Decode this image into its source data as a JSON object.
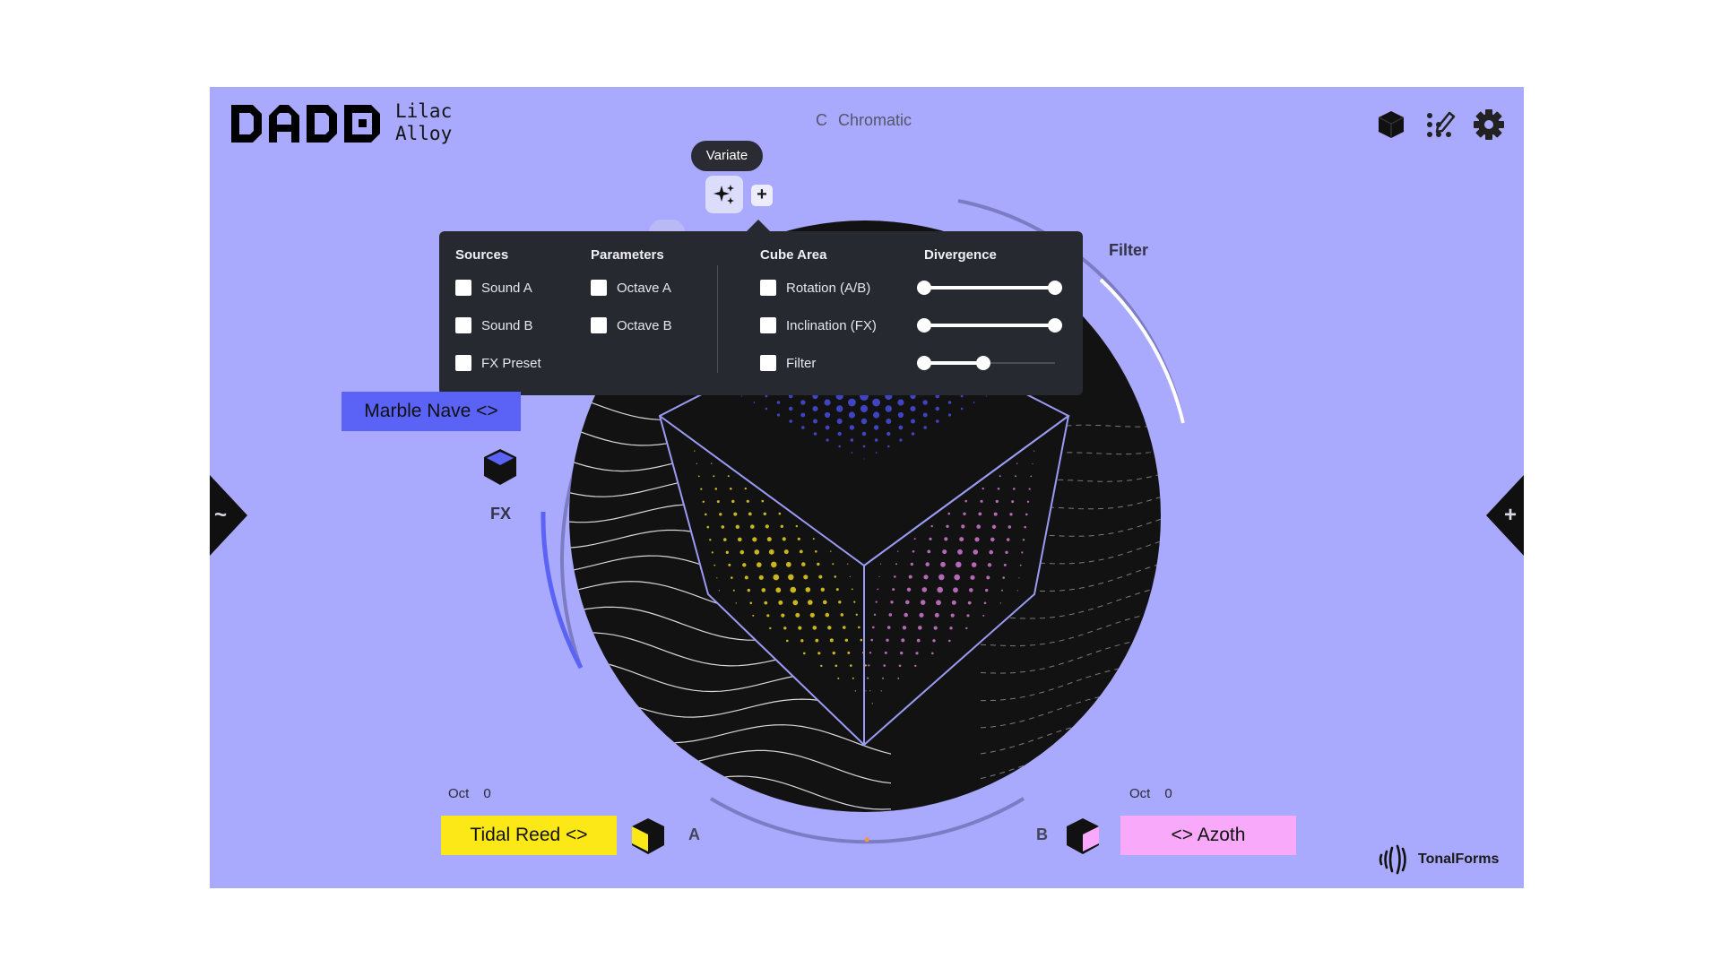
{
  "header": {
    "preset_name_line1": "Lilac",
    "preset_name_line2": "Alloy",
    "scale_key": "C",
    "scale_name": "Chromatic"
  },
  "toolbar": {
    "icons": [
      "cube-icon",
      "edit-grid-icon",
      "settings-gear-icon"
    ]
  },
  "variate": {
    "tooltip": "Variate",
    "plus_label": "+"
  },
  "popup": {
    "sources": {
      "heading": "Sources",
      "items": [
        {
          "label": "Sound A",
          "checked": false
        },
        {
          "label": "Sound B",
          "checked": false
        },
        {
          "label": "FX Preset",
          "checked": false
        }
      ]
    },
    "parameters": {
      "heading": "Parameters",
      "items": [
        {
          "label": "Octave A",
          "checked": false
        },
        {
          "label": "Octave B",
          "checked": false
        }
      ]
    },
    "cube_area": {
      "heading": "Cube Area",
      "items": [
        {
          "label": "Rotation (A/B)",
          "checked": false
        },
        {
          "label": "Inclination (FX)",
          "checked": false
        },
        {
          "label": "Filter",
          "checked": false
        }
      ]
    },
    "divergence": {
      "heading": "Divergence",
      "values": [
        1.0,
        1.0,
        0.45
      ]
    }
  },
  "filter_label": "Filter",
  "fx": {
    "label": "FX",
    "preset": "Marble Nave <>",
    "color": "#5a63f6"
  },
  "sound_a": {
    "letter": "A",
    "preset": "Tidal Reed <>",
    "oct_label": "Oct",
    "oct_value": "0",
    "color": "#fbe816"
  },
  "sound_b": {
    "letter": "B",
    "preset": "<> Azoth",
    "oct_label": "Oct",
    "oct_value": "0",
    "color": "#f8a9f9"
  },
  "side_tabs": {
    "left_glyph": "~",
    "right_glyph": "+"
  },
  "brand": "TonalForms",
  "colors": {
    "background": "#a9a9fd",
    "popup": "#272931",
    "dark_disc": "#121212"
  }
}
